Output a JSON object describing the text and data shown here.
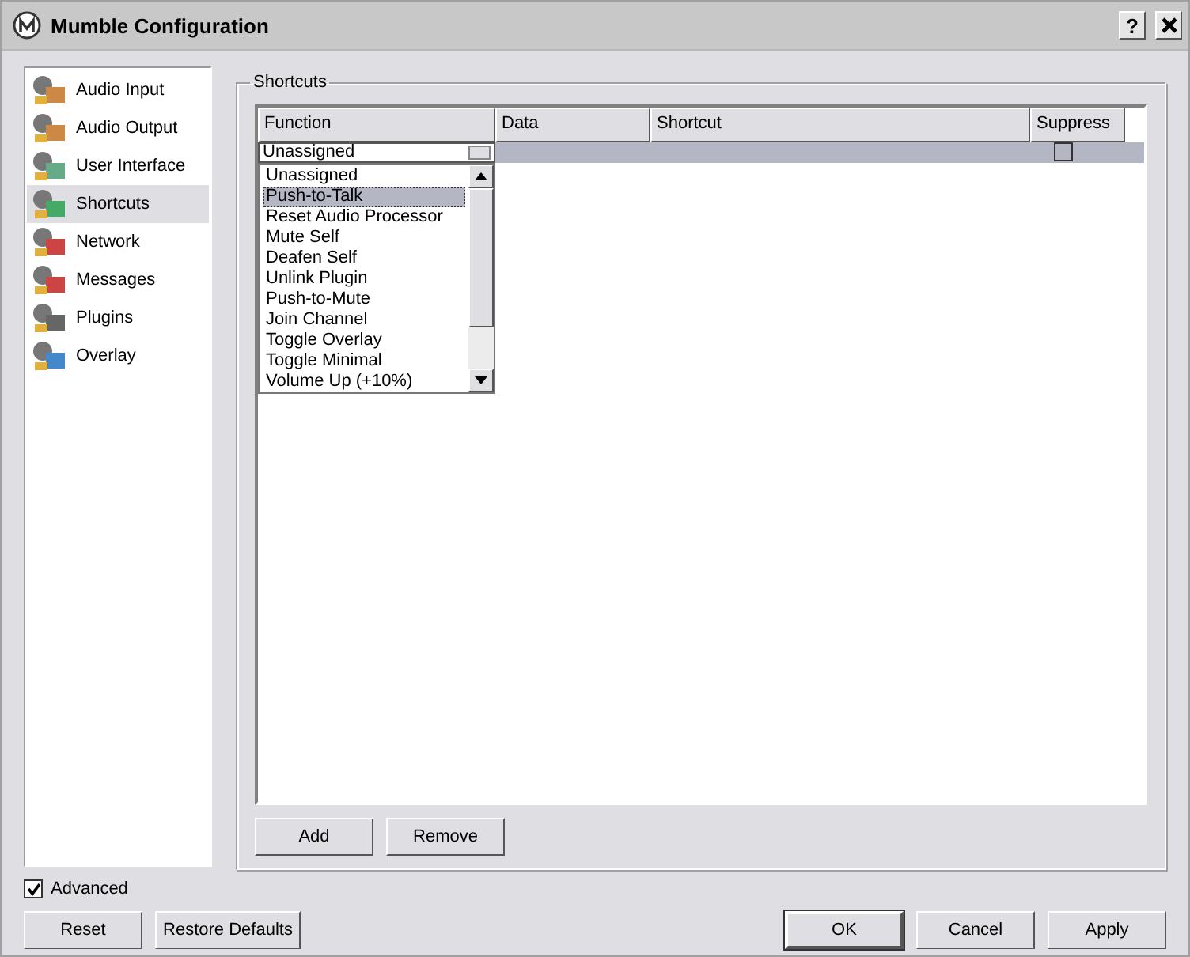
{
  "window": {
    "title": "Mumble Configuration",
    "help": "?"
  },
  "sidebar": {
    "items": [
      {
        "label": "Audio Input",
        "selected": false
      },
      {
        "label": "Audio Output",
        "selected": false
      },
      {
        "label": "User Interface",
        "selected": false
      },
      {
        "label": "Shortcuts",
        "selected": true
      },
      {
        "label": "Network",
        "selected": false
      },
      {
        "label": "Messages",
        "selected": false
      },
      {
        "label": "Plugins",
        "selected": false
      },
      {
        "label": "Overlay",
        "selected": false
      }
    ]
  },
  "group": {
    "title": "Shortcuts"
  },
  "table": {
    "columns": [
      "Function",
      "Data",
      "Shortcut",
      "Suppress"
    ],
    "rows": [
      {
        "function": "Unassigned",
        "suppress": false,
        "selected": true
      }
    ]
  },
  "dropdown": {
    "items": [
      {
        "label": "Unassigned",
        "selected": false
      },
      {
        "label": "Push-to-Talk",
        "selected": true
      },
      {
        "label": "Reset Audio Processor",
        "selected": false
      },
      {
        "label": "Mute Self",
        "selected": false
      },
      {
        "label": "Deafen Self",
        "selected": false
      },
      {
        "label": "Unlink Plugin",
        "selected": false
      },
      {
        "label": "Push-to-Mute",
        "selected": false
      },
      {
        "label": "Join Channel",
        "selected": false
      },
      {
        "label": "Toggle Overlay",
        "selected": false
      },
      {
        "label": "Toggle Minimal",
        "selected": false
      },
      {
        "label": "Volume Up (+10%)",
        "selected": false
      }
    ]
  },
  "table_buttons": [
    "Add",
    "Remove"
  ],
  "advanced": {
    "label": "Advanced",
    "checked": true
  },
  "footer_left": [
    {
      "label": "Reset",
      "is_default": false
    },
    {
      "label": "Restore Defaults",
      "is_default": false
    }
  ],
  "footer_right": [
    {
      "label": "OK",
      "is_default": true
    },
    {
      "label": "Cancel",
      "is_default": false
    },
    {
      "label": "Apply",
      "is_default": false
    }
  ]
}
